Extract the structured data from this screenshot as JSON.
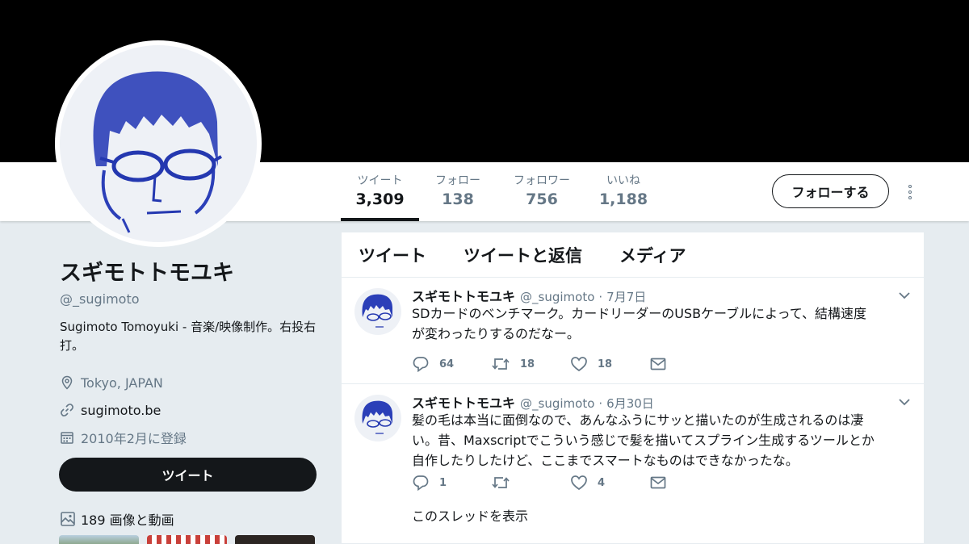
{
  "profile": {
    "name": "スギモトトモユキ",
    "handle": "@_sugimoto",
    "bio": "Sugimoto Tomoyuki - 音楽/映像制作。右投右打。",
    "location": "Tokyo, JAPAN",
    "website": "sugimoto.be",
    "joined": "2010年2月に登録"
  },
  "stats": [
    {
      "label": "ツイート",
      "value": "3,309"
    },
    {
      "label": "フォロー",
      "value": "138"
    },
    {
      "label": "フォロワー",
      "value": "756"
    },
    {
      "label": "いいね",
      "value": "1,188"
    }
  ],
  "actions": {
    "follow_label": "フォローする",
    "tweet_label": "ツイート"
  },
  "media": {
    "label": "189 画像と動画"
  },
  "tabs": [
    "ツイート",
    "ツイートと返信",
    "メディア"
  ],
  "tweets": [
    {
      "name": "スギモトトモユキ",
      "handle": "@_sugimoto",
      "date": "7月7日",
      "line1": "SDカードのベンチマーク。カードリーダーのUSBケーブルによって、結構速度",
      "line2": "が変わったりするのだなー。",
      "replies": "64",
      "retweets": "18",
      "likes": "18"
    },
    {
      "name": "スギモトトモユキ",
      "handle": "@_sugimoto",
      "date": "6月30日",
      "line1": "髪の毛は本当に面倒なので、あんなふうにサッと描いたのが生成されるのは凄",
      "line2": "い。昔、Maxscriptでこういう感じで髪を描いてスプライン生成するツールとか",
      "line3": "自作したりしたけど、ここまでスマートなものはできなかったな。",
      "replies": "1",
      "retweets": "",
      "likes": "4",
      "thread_label": "このスレッドを表示"
    }
  ],
  "colors": {
    "text": "#14171a",
    "secondary": "#657786",
    "background": "#e6ecf0",
    "banner": "#000000"
  }
}
